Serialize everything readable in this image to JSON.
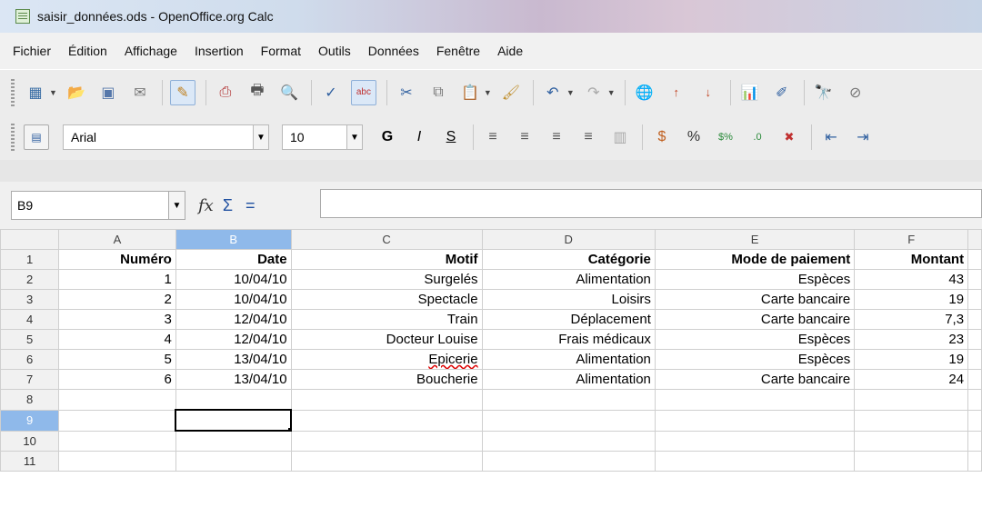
{
  "window": {
    "title": "saisir_données.ods - OpenOffice.org Calc"
  },
  "menu": [
    "Fichier",
    "Édition",
    "Affichage",
    "Insertion",
    "Format",
    "Outils",
    "Données",
    "Fenêtre",
    "Aide"
  ],
  "toolbar": {
    "font_name": "Arial",
    "font_size": "10",
    "bold_label": "G",
    "italic_label": "I",
    "underline_label": "S"
  },
  "formula_bar": {
    "cell_ref": "B9",
    "content": ""
  },
  "sheet": {
    "columns": [
      "A",
      "B",
      "C",
      "D",
      "E",
      "F"
    ],
    "selected_column": "B",
    "selected_row": "9",
    "row_numbers": [
      "1",
      "2",
      "3",
      "4",
      "5",
      "6",
      "7",
      "8",
      "9",
      "10",
      "11"
    ],
    "headers": [
      "Numéro",
      "Date",
      "Motif",
      "Catégorie",
      "Mode de paiement",
      "Montant"
    ],
    "rows": [
      [
        "1",
        "10/04/10",
        "Surgelés",
        "Alimentation",
        "Espèces",
        "43"
      ],
      [
        "2",
        "10/04/10",
        "Spectacle",
        "Loisirs",
        "Carte bancaire",
        "19"
      ],
      [
        "3",
        "12/04/10",
        "Train",
        "Déplacement",
        "Carte bancaire",
        "7,3"
      ],
      [
        "4",
        "12/04/10",
        "Docteur Louise",
        "Frais médicaux",
        "Espèces",
        "23"
      ],
      [
        "5",
        "13/04/10",
        "Epicerie",
        "Alimentation",
        "Espèces",
        "19"
      ],
      [
        "6",
        "13/04/10",
        "Boucherie",
        "Alimentation",
        "Carte bancaire",
        "24"
      ]
    ]
  }
}
